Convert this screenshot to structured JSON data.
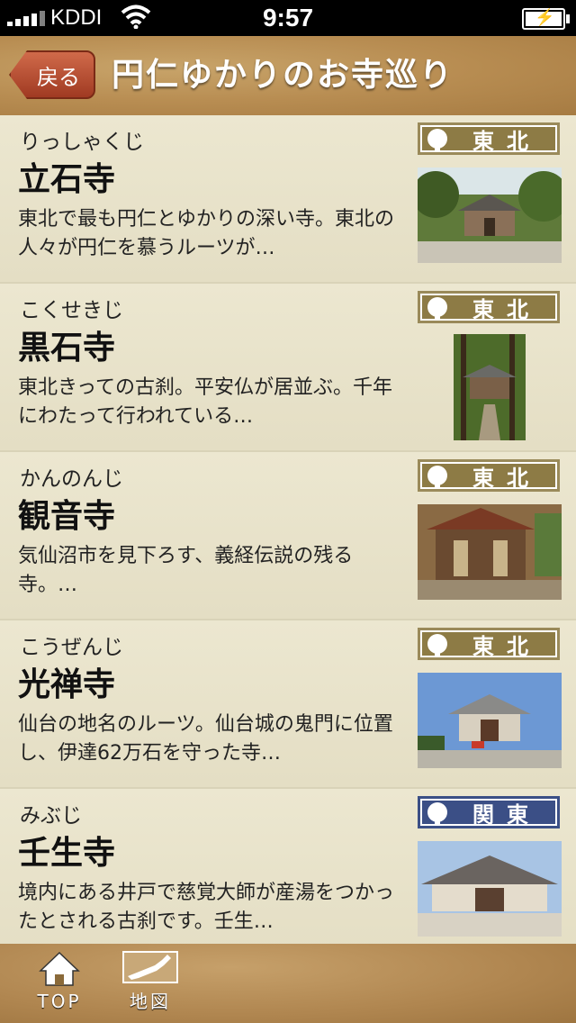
{
  "status_bar": {
    "carrier": "KDDI",
    "time": "9:57"
  },
  "header": {
    "back_label": "戻る",
    "title": "円仁ゆかりのお寺巡り"
  },
  "temples": [
    {
      "ruby": "りっしゃくじ",
      "name": "立石寺",
      "description": "東北で最も円仁とゆかりの深い寺。東北の人々が円仁を慕うルーツが…",
      "region": "東北"
    },
    {
      "ruby": "こくせきじ",
      "name": "黒石寺",
      "description": "東北きっての古刹。平安仏が居並ぶ。千年にわたって行われている…",
      "region": "東北"
    },
    {
      "ruby": "かんのんじ",
      "name": "観音寺",
      "description": "気仙沼市を見下ろす、義経伝説の残る寺。…",
      "region": "東北"
    },
    {
      "ruby": "こうぜんじ",
      "name": "光禅寺",
      "description": "仙台の地名のルーツ。仙台城の鬼門に位置し、伊達62万石を守った寺…",
      "region": "東北"
    },
    {
      "ruby": "みぶじ",
      "name": "壬生寺",
      "description": "境内にある井戸で慈覚大師が産湯をつかったとされる古刹です。壬生…",
      "region": "関東"
    }
  ],
  "tabbar": {
    "top_label": "TOP",
    "map_label": "地図"
  },
  "colors": {
    "tohoku_tag": "#8d7b45",
    "kanto_tag": "#3b4f86",
    "back_button": "#b8492e"
  }
}
